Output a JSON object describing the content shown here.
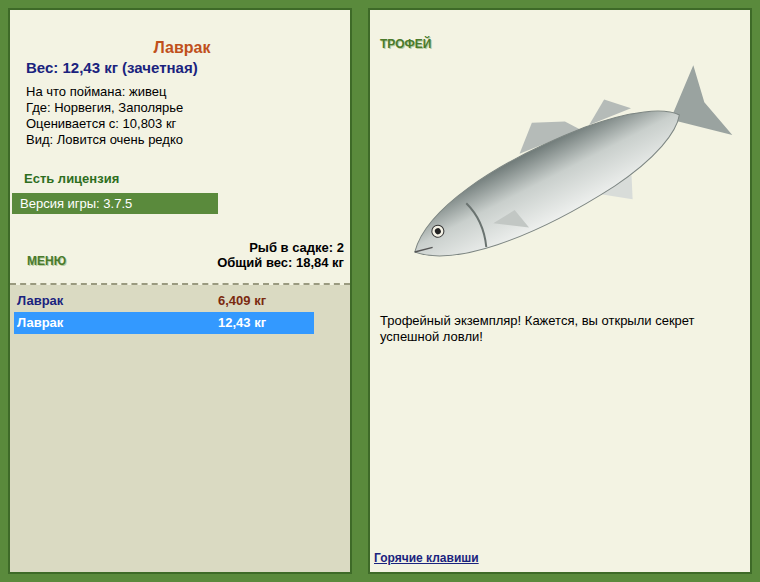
{
  "fish_card": {
    "name": "Лаврак",
    "weight": "Вес: 12,43 кг (зачетная)",
    "info": [
      "На что поймана: живец",
      "Где: Норвегия, Заполярье",
      "Оценивается с: 10,803 кг",
      "Вид: Ловится очень редко"
    ],
    "license": "Есть лицензия",
    "version": "Версия игры: 3.7.5"
  },
  "menu": {
    "label": "МЕНЮ"
  },
  "cage": {
    "count": "Рыб в садке: 2",
    "total": "Общий вес: 18,84 кг"
  },
  "catch_list": [
    {
      "name": "Лаврак",
      "weight": "6,409 кг",
      "selected": false
    },
    {
      "name": "Лаврак",
      "weight": "12,43 кг",
      "selected": true
    }
  ],
  "trophy": {
    "label": "ТРОФЕЙ",
    "description": "Трофейный экземпляр! Кажется, вы открыли секрет успешной ловли!"
  },
  "hotkeys": "Горячие клавиши"
}
